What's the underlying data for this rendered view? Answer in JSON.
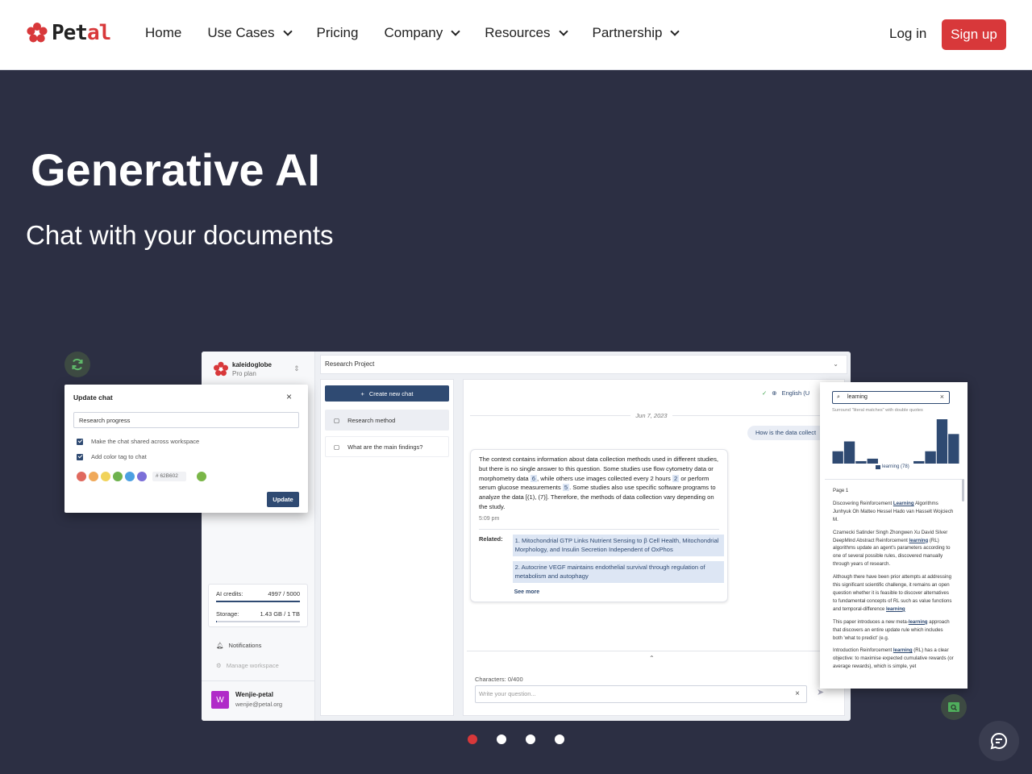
{
  "nav": {
    "logo_prefix": "Pet",
    "logo_suffix": "al",
    "items": [
      {
        "label": "Home",
        "dropdown": false
      },
      {
        "label": "Use Cases",
        "dropdown": true
      },
      {
        "label": "Pricing",
        "dropdown": false
      },
      {
        "label": "Company",
        "dropdown": true
      },
      {
        "label": "Resources",
        "dropdown": true
      },
      {
        "label": "Partnership",
        "dropdown": true
      }
    ],
    "login": "Log in",
    "signup": "Sign up"
  },
  "hero": {
    "title": "Generative AI",
    "subtitle": "Chat with your documents"
  },
  "app": {
    "workspace": {
      "name": "kaleidoglobe",
      "plan": "Pro plan"
    },
    "project": "Research Project",
    "create_chat": "Create new chat",
    "chats": [
      "Research method",
      "What are the main findings?"
    ],
    "credits": {
      "label": "AI credits:",
      "value": "4997 / 5000",
      "fraction": 0.9994
    },
    "storage": {
      "label": "Storage:",
      "value": "1.43 GB / 1 TB",
      "fraction": 0.0014
    },
    "notifications": "Notifications",
    "manage": "Manage workspace",
    "user": {
      "initial": "W",
      "name": "Wenjie-petal",
      "email": "wenjie@petal.org"
    },
    "language": "English (U",
    "date": "Jun 7, 2023",
    "question": "How is the data collect",
    "answer": {
      "t1": "The context contains information about data collection methods used in different studies, but there is no single answer to this question. Some studies use flow cytometry data or morphometry data ",
      "c1": "6",
      "t2": ", while others use images collected every 2 hours ",
      "c2": "2",
      "t3": " or perform serum glucose measurements ",
      "c3": "5",
      "t4": ". Some studies also use specific software programs to analyze the data [(1), (7)]. Therefore, the methods of data collection vary depending on the study.",
      "time": "5:09 pm",
      "related_label": "Related:",
      "related": [
        "1. Mitochondrial GTP Links Nutrient Sensing to β Cell Health, Mitochondrial Morphology, and Insulin Secretion Independent of OxPhos",
        "2. Autocrine VEGF maintains endothelial survival through regulation of metabolism and autophagy"
      ],
      "see_more": "See more"
    },
    "composer": {
      "char_count": "Characters: 0/400",
      "placeholder": "Write your question..."
    }
  },
  "dialog": {
    "title": "Update chat",
    "input_value": "Research progress",
    "check_shared": "Make the chat shared across workspace",
    "check_color": "Add color tag to chat",
    "hex_symbol": "#",
    "hex_value": "62B602",
    "swatch_colors": [
      "#e0695e",
      "#f0a95a",
      "#f1d35a",
      "#6fb24e",
      "#4ca0e2",
      "#7b6fd8"
    ],
    "picked_color": "#7ab648",
    "update": "Update"
  },
  "pdf": {
    "search_value": "learning",
    "hint": "Surround \"literal matches\" with double quotes",
    "histogram": [
      5,
      9,
      1,
      2,
      0,
      0,
      0,
      1,
      5,
      18,
      12
    ],
    "legend": "learning (78)",
    "page_label": "Page 1",
    "paras": [
      {
        "a": "Discovering Reinforcement ",
        "hl": "Learning",
        "b": " Algorithms Junhyuk Oh Matteo Hessel Hado van Hasselt Wojciech M."
      },
      {
        "a": "Czarnecki Satinder Singh Zhongwen Xu David Silver DeepMind Abstract Reinforcement ",
        "hl": "learning",
        "b": " (RL) algorithms update an agent's parameters according to one of several possible rules, discovered manually through years of research."
      },
      {
        "a": "Although there have been prior attempts at addressing this significant scientific challenge, it remains an open question whether it is feasible to discover alternatives to fundamental concepts of RL such as value functions and temporal-difference ",
        "hl": "learning",
        "b": ""
      },
      {
        "a": "This paper introduces a new meta-",
        "hl": "learning",
        "b": " approach that discovers an entire update rule which includes both 'what to predict' (e.g."
      },
      {
        "a": "Introduction Reinforcement ",
        "hl": "learning",
        "b": " (RL) has a clear objective: to maximise expected cumulative rewards (or average rewards), which is simple, yet"
      }
    ]
  },
  "carousel": {
    "count": 4,
    "active": 0
  },
  "colors": {
    "brand_red": "#d8383a",
    "hero_bg": "#2c2f43",
    "app_accent": "#2f4a72"
  }
}
